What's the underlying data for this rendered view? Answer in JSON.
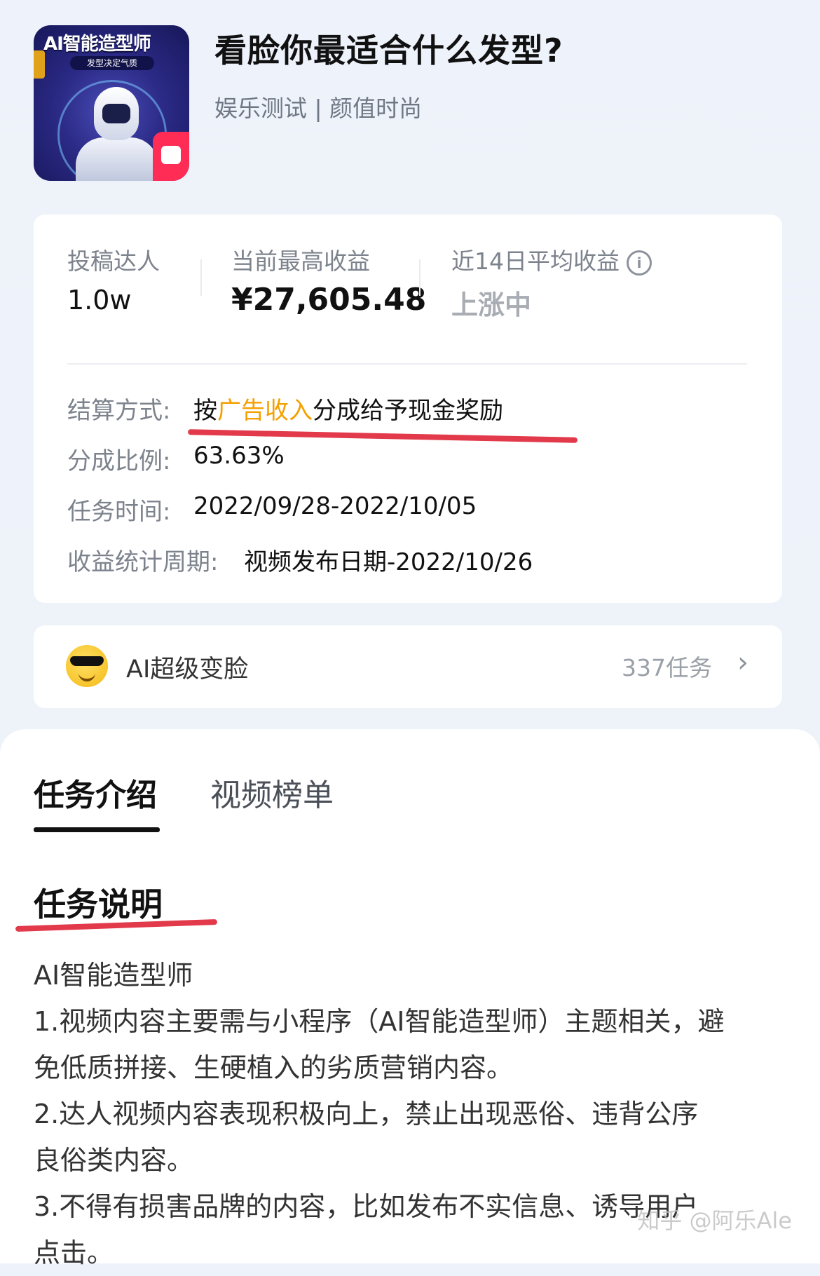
{
  "header": {
    "cover_title": "AI智能造型师",
    "cover_subtitle": "发型决定气质",
    "title": "看脸你最适合什么发型?",
    "category": "娱乐测试 | 颜值时尚"
  },
  "stats": {
    "submitters": {
      "label": "投稿达人",
      "value": "1.0w"
    },
    "top_earning": {
      "label": "当前最高收益",
      "value": "¥27,605.48"
    },
    "avg_14d": {
      "label": "近14日平均收益",
      "value": "上涨中",
      "info_icon": "i"
    }
  },
  "details": {
    "settlement": {
      "label": "结算方式:",
      "prefix": "按",
      "highlight": "广告收入",
      "suffix": "分成给予现金奖励"
    },
    "ratio": {
      "label": "分成比例:",
      "value": "63.63%"
    },
    "task_time": {
      "label": "任务时间:",
      "value": "2022/09/28-2022/10/05"
    },
    "stats_period": {
      "label": "收益统计周期:",
      "value": "视频发布日期-2022/10/26"
    }
  },
  "tool": {
    "name": "AI超级变脸",
    "count": "337任务",
    "chevron": "›"
  },
  "tabs": [
    {
      "label": "任务介绍",
      "active": true
    },
    {
      "label": "视频榜单",
      "active": false
    }
  ],
  "task": {
    "section_title": "任务说明",
    "lines": [
      "AI智能造型师",
      "1.视频内容主要需与小程序（AI智能造型师）主题相关，避",
      "免低质拼接、生硬植入的劣质营销内容。",
      "2.达人视频内容表现积极向上，禁止出现恶俗、违背公序",
      "良俗类内容。",
      "3.不得有损害品牌的内容，比如发布不实信息、诱导用户",
      "点击。"
    ]
  },
  "watermark": "知乎 @阿乐Ale",
  "colors": {
    "highlight": "#f4a000",
    "annotation_red": "#e23a4a"
  }
}
